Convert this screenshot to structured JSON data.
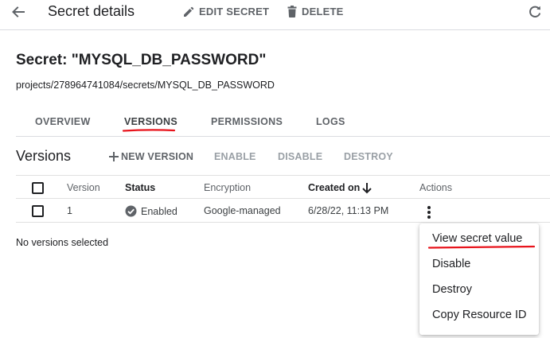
{
  "header": {
    "title": "Secret details",
    "edit_label": "EDIT SECRET",
    "delete_label": "DELETE"
  },
  "secret": {
    "heading": "Secret: \"MYSQL_DB_PASSWORD\"",
    "path": "projects/278964741084/secrets/MYSQL_DB_PASSWORD"
  },
  "tabs": [
    {
      "label": "OVERVIEW"
    },
    {
      "label": "VERSIONS",
      "active": true
    },
    {
      "label": "PERMISSIONS"
    },
    {
      "label": "LOGS"
    }
  ],
  "versions": {
    "title": "Versions",
    "new_version_label": "NEW VERSION",
    "enable_label": "ENABLE",
    "disable_label": "DISABLE",
    "destroy_label": "DESTROY"
  },
  "table": {
    "columns": [
      "Version",
      "Status",
      "Encryption",
      "Created on",
      "Actions"
    ],
    "rows": [
      {
        "version": "1",
        "status": "Enabled",
        "encryption": "Google-managed",
        "created_on": "6/28/22, 11:13 PM"
      }
    ]
  },
  "selection_text": "No versions selected",
  "menu": {
    "items": [
      "View secret value",
      "Disable",
      "Destroy",
      "Copy Resource ID"
    ]
  },
  "colors": {
    "annotation_red": "#e8141c",
    "status_icon": "#5f6368",
    "muted_text": "#5f6368",
    "disabled_text": "#9aa0a6"
  },
  "icons": [
    "back-arrow-icon",
    "pencil-icon",
    "trash-icon",
    "refresh-icon",
    "plus-icon",
    "arrow-down-icon",
    "check-circle-icon",
    "more-vert-icon"
  ]
}
